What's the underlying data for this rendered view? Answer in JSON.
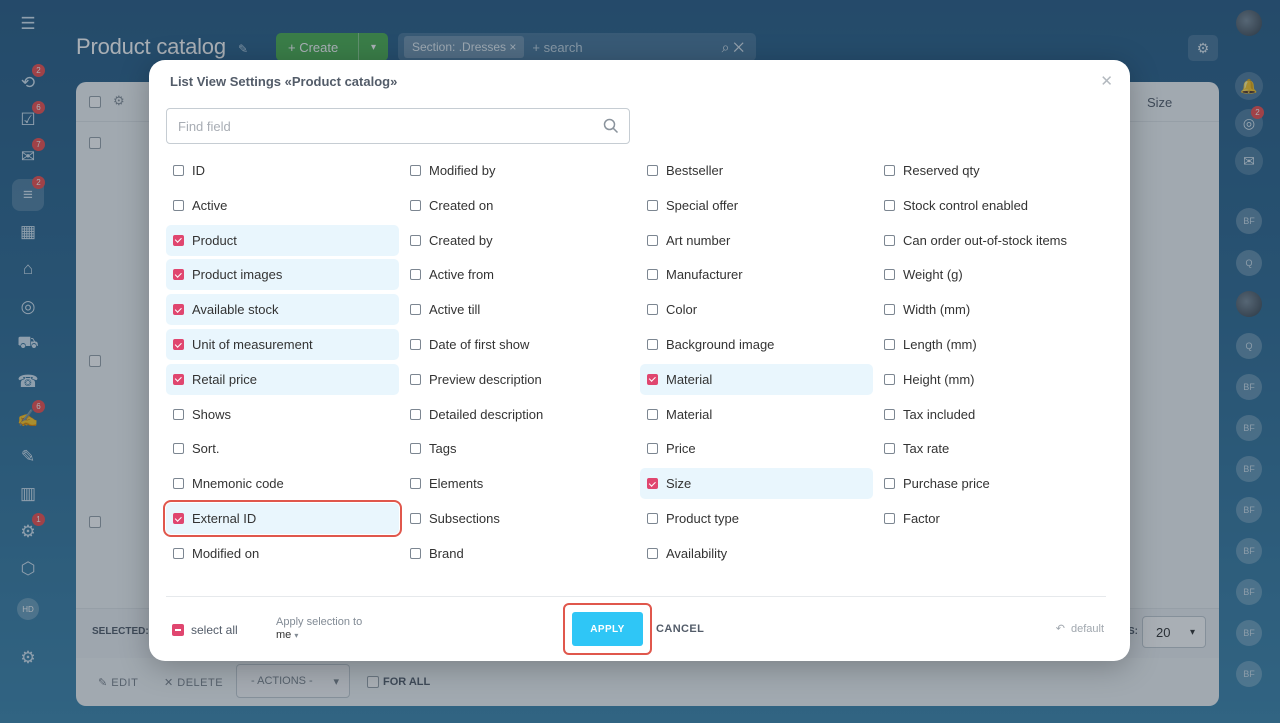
{
  "app": {
    "title": "Product catalog",
    "create_label": "+ Create",
    "filter_tag": "Section: .Dresses",
    "filter_placeholder": "+ search"
  },
  "left_sidebar": {
    "items": [
      {
        "icon": "hamburger-icon"
      },
      {
        "icon": "activity-icon",
        "badge": "2"
      },
      {
        "icon": "tasks-icon",
        "badge": "6"
      },
      {
        "icon": "chat-icon",
        "badge": "7"
      },
      {
        "icon": "crm-icon",
        "badge": "2"
      },
      {
        "icon": "calendar-icon"
      },
      {
        "icon": "store-icon"
      },
      {
        "icon": "target-icon"
      },
      {
        "icon": "cart-icon"
      },
      {
        "icon": "contact-center-icon"
      },
      {
        "icon": "document-icon",
        "badge": "6"
      },
      {
        "icon": "sign-icon"
      },
      {
        "icon": "analytics-icon"
      },
      {
        "icon": "automation-icon",
        "badge": "1"
      },
      {
        "icon": "box-icon"
      }
    ],
    "hd_label": "HD",
    "settings_icon": "gear-icon"
  },
  "right_sidebar": {
    "avatars": [
      "BF",
      "Q",
      "BF",
      "Q",
      "BF",
      "BF",
      "BF",
      "BF",
      "BF",
      "BF",
      "BF",
      "BF"
    ],
    "notif_badge": "2"
  },
  "grid": {
    "size_header": "Size",
    "selected_label": "SELECTED:",
    "pages_label": "S:",
    "pages_value": "20",
    "edit_label": "EDIT",
    "delete_label": "DELETE",
    "actions_label": "- ACTIONS -",
    "for_all_label": "FOR ALL"
  },
  "modal": {
    "title": "List View Settings «Product catalog»",
    "search_placeholder": "Find field",
    "columns": [
      [
        {
          "label": "ID",
          "checked": false
        },
        {
          "label": "Active",
          "checked": false
        },
        {
          "label": "Product",
          "checked": true
        },
        {
          "label": "Product images",
          "checked": true
        },
        {
          "label": "Available stock",
          "checked": true
        },
        {
          "label": "Unit of measurement",
          "checked": true
        },
        {
          "label": "Retail price",
          "checked": true
        },
        {
          "label": "Shows",
          "checked": false
        },
        {
          "label": "Sort.",
          "checked": false
        },
        {
          "label": "Mnemonic code",
          "checked": false
        },
        {
          "label": "External ID",
          "checked": true,
          "highlighted": true
        },
        {
          "label": "Modified on",
          "checked": false
        }
      ],
      [
        {
          "label": "Modified by",
          "checked": false
        },
        {
          "label": "Created on",
          "checked": false
        },
        {
          "label": "Created by",
          "checked": false
        },
        {
          "label": "Active from",
          "checked": false
        },
        {
          "label": "Active till",
          "checked": false
        },
        {
          "label": "Date of first show",
          "checked": false
        },
        {
          "label": "Preview description",
          "checked": false
        },
        {
          "label": "Detailed description",
          "checked": false
        },
        {
          "label": "Tags",
          "checked": false
        },
        {
          "label": "Elements",
          "checked": false
        },
        {
          "label": "Subsections",
          "checked": false
        },
        {
          "label": "Brand",
          "checked": false
        }
      ],
      [
        {
          "label": "Bestseller",
          "checked": false
        },
        {
          "label": "Special offer",
          "checked": false
        },
        {
          "label": "Art number",
          "checked": false
        },
        {
          "label": "Manufacturer",
          "checked": false
        },
        {
          "label": "Color",
          "checked": false
        },
        {
          "label": "Background image",
          "checked": false
        },
        {
          "label": "Material",
          "checked": true
        },
        {
          "label": "Material",
          "checked": false
        },
        {
          "label": "Price",
          "checked": false
        },
        {
          "label": "Size",
          "checked": true
        },
        {
          "label": "Product type",
          "checked": false
        },
        {
          "label": "Availability",
          "checked": false
        }
      ],
      [
        {
          "label": "Reserved qty",
          "checked": false
        },
        {
          "label": "Stock control enabled",
          "checked": false
        },
        {
          "label": "Can order out-of-stock items",
          "checked": false
        },
        {
          "label": "Weight (g)",
          "checked": false
        },
        {
          "label": "Width (mm)",
          "checked": false
        },
        {
          "label": "Length (mm)",
          "checked": false
        },
        {
          "label": "Height (mm)",
          "checked": false
        },
        {
          "label": "Tax included",
          "checked": false
        },
        {
          "label": "Tax rate",
          "checked": false
        },
        {
          "label": "Purchase price",
          "checked": false
        },
        {
          "label": "Factor",
          "checked": false
        }
      ]
    ],
    "select_all_label": "select all",
    "apply_to_label": "Apply selection to",
    "apply_to_value": "me",
    "apply_label": "APPLY",
    "cancel_label": "CANCEL",
    "default_label": "default"
  },
  "colors": {
    "accent_check": "#e0466f",
    "apply_button": "#2fc6f6",
    "highlight_frame": "#e0574c",
    "checked_row_bg": "#e9f6fd"
  }
}
